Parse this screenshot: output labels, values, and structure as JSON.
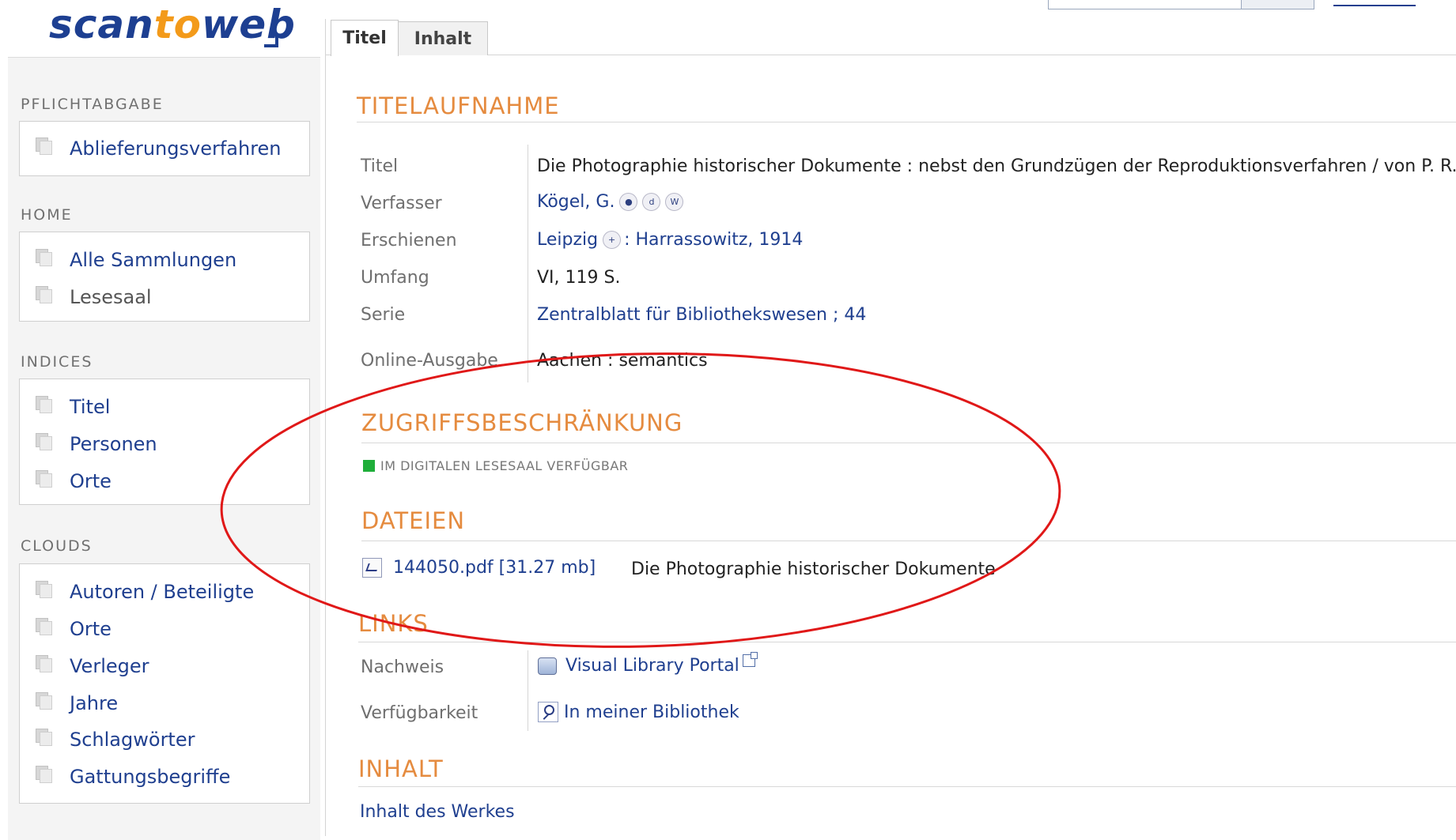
{
  "logo": {
    "part1": "scan",
    "part2": "to",
    "part3": "web"
  },
  "tabs": [
    {
      "label": "Titel"
    },
    {
      "label": "Inhalt"
    }
  ],
  "sidebar": {
    "sections": [
      {
        "title": "PFLICHTABGABE",
        "items": [
          {
            "label": "Ablieferungsverfahren"
          }
        ]
      },
      {
        "title": "HOME",
        "items": [
          {
            "label": "Alle Sammlungen"
          },
          {
            "label": "Lesesaal"
          }
        ]
      },
      {
        "title": "INDICES",
        "items": [
          {
            "label": "Titel"
          },
          {
            "label": "Personen"
          },
          {
            "label": "Orte"
          }
        ]
      },
      {
        "title": "CLOUDS",
        "items": [
          {
            "label": "Autoren / Beteiligte"
          },
          {
            "label": "Orte"
          },
          {
            "label": "Verleger"
          },
          {
            "label": "Jahre"
          },
          {
            "label": "Schlagwörter"
          },
          {
            "label": "Gattungsbegriffe"
          }
        ]
      }
    ]
  },
  "main": {
    "titelaufnahme": {
      "heading": "TITELAUFNAHME",
      "rows": [
        {
          "label": "Titel",
          "value": "Die Photographie historischer Dokumente : nebst den Grundzügen der Reproduktionsverfahren / von P. R. Kögel"
        },
        {
          "label": "Verfasser",
          "value": "Kögel, G.",
          "icons": [
            "person-icon",
            "dnb-icon",
            "wikipedia-icon"
          ]
        },
        {
          "label": "Erschienen",
          "value_place": "Leipzig",
          "value_rest": " : Harrassowitz, 1914"
        },
        {
          "label": "Umfang",
          "value": "VI, 119 S."
        },
        {
          "label": "Serie",
          "value": "Zentralblatt für Bibliothekswesen ; 44"
        },
        {
          "label": "Online-Ausgabe",
          "value": "Aachen : semantics"
        }
      ]
    },
    "zugriff": {
      "heading": "ZUGRIFFSBESCHRÄNKUNG",
      "status": "IM DIGITALEN LESESAAL VERFÜGBAR",
      "status_color": "#1fae3a"
    },
    "dateien": {
      "heading": "DATEIEN",
      "file_link": "144050.pdf [31.27 mb]",
      "file_desc": "Die Photographie historischer Dokumente"
    },
    "links": {
      "heading": "LINKS",
      "rows": [
        {
          "label": "Nachweis",
          "value": "Visual Library Portal"
        },
        {
          "label": "Verfügbarkeit",
          "value": "In meiner Bibliothek"
        }
      ]
    },
    "inhalt": {
      "heading": "INHALT",
      "link": "Inhalt des Werkes"
    }
  },
  "colors": {
    "accent_heading": "#e58b3f",
    "link": "#1f3f8f",
    "annotation": "#e01818"
  }
}
